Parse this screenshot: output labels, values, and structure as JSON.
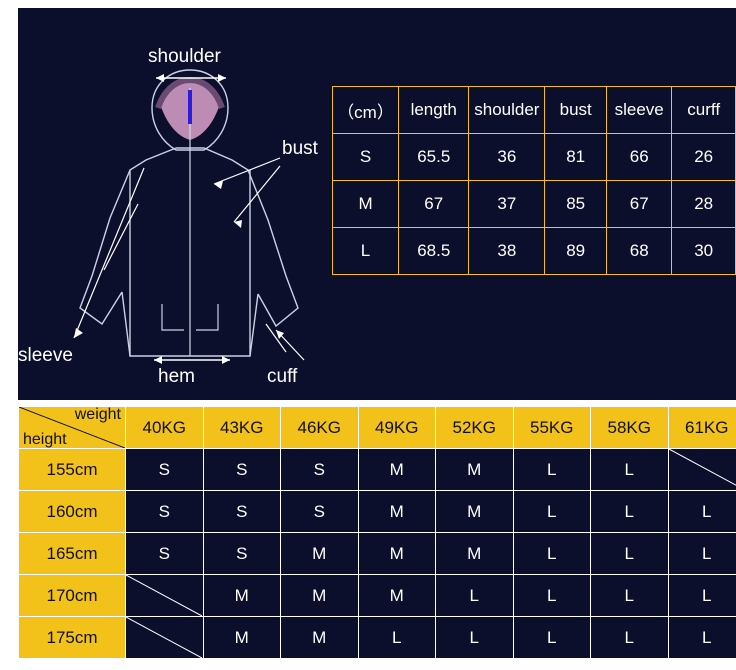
{
  "diagram": {
    "labels": {
      "shoulder": "shoulder",
      "bust": "bust",
      "sleeve": "sleeve",
      "hem": "hem",
      "cuff": "cuff"
    }
  },
  "size_table": {
    "headers": [
      "（cm）",
      "length",
      "shoulder",
      "bust",
      "sleeve",
      "curff"
    ],
    "rows": [
      [
        "S",
        "65.5",
        "36",
        "81",
        "66",
        "26"
      ],
      [
        "M",
        "67",
        "37",
        "85",
        "67",
        "28"
      ],
      [
        "L",
        "68.5",
        "38",
        "89",
        "68",
        "30"
      ]
    ]
  },
  "fit_chart": {
    "corner_weight_label": "weight",
    "corner_height_label": "height",
    "weights": [
      "40KG",
      "43KG",
      "46KG",
      "49KG",
      "52KG",
      "55KG",
      "58KG",
      "61KG"
    ],
    "heights": [
      "155cm",
      "160cm",
      "165cm",
      "170cm",
      "175cm"
    ],
    "rows": [
      [
        "S",
        "S",
        "S",
        "M",
        "M",
        "L",
        "L",
        ""
      ],
      [
        "S",
        "S",
        "S",
        "M",
        "M",
        "L",
        "L",
        "L"
      ],
      [
        "S",
        "S",
        "M",
        "M",
        "M",
        "L",
        "L",
        "L"
      ],
      [
        "",
        "M",
        "M",
        "M",
        "L",
        "L",
        "L",
        "L"
      ],
      [
        "",
        "M",
        "M",
        "L",
        "L",
        "L",
        "L",
        "L"
      ]
    ],
    "slashed_cells": [
      [
        0,
        7
      ],
      [
        3,
        0
      ],
      [
        4,
        0
      ]
    ]
  },
  "colors": {
    "panel_background": "#0b0f2b",
    "accent_yellow": "#f3c21a",
    "text_light": "#ffffff"
  }
}
